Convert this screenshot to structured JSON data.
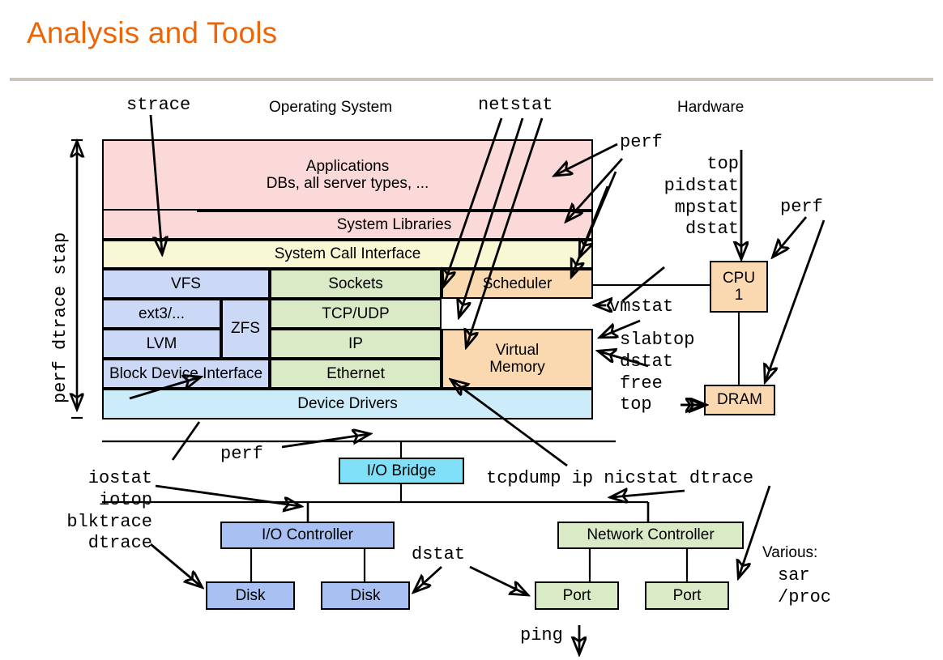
{
  "slide": {
    "title": "Analysis and Tools"
  },
  "headers": {
    "operating_system": "Operating System",
    "hardware": "Hardware"
  },
  "left_axis": {
    "label": "perf dtrace stap"
  },
  "os_stack": {
    "applications_line1": "Applications",
    "applications_line2": "DBs, all server types, ...",
    "system_libraries": "System Libraries",
    "system_call_interface": "System Call Interface",
    "vfs": "VFS",
    "ext3": "ext3/...",
    "zfs": "ZFS",
    "lvm": "LVM",
    "block_device_interface": "Block Device Interface",
    "sockets": "Sockets",
    "tcp_udp": "TCP/UDP",
    "ip": "IP",
    "ethernet": "Ethernet",
    "scheduler": "Scheduler",
    "virtual_memory_line1": "Virtual",
    "virtual_memory_line2": "Memory",
    "device_drivers": "Device Drivers"
  },
  "hardware": {
    "cpu_line1": "CPU",
    "cpu_line2": "1",
    "dram": "DRAM",
    "io_bridge": "I/O Bridge",
    "io_controller": "I/O Controller",
    "network_controller": "Network Controller",
    "disk_1": "Disk",
    "disk_2": "Disk",
    "port_1": "Port",
    "port_2": "Port"
  },
  "tools": {
    "strace": "strace",
    "netstat": "netstat",
    "perf_top_right": "perf",
    "cpu_tools": "top\npidstat\nmpstat\ndstat",
    "perf_cpu": "perf",
    "vmstat": "vmstat",
    "memory_tools": "slabtop\ndstat\nfree\ntop",
    "perf_bridge": "perf",
    "io_tools": "iostat\niotop\nblktrace\ndtrace",
    "net_tools": "tcpdump ip nicstat dtrace",
    "dstat": "dstat",
    "ping": "ping",
    "various_label": "Various:",
    "various_tools": "sar\n/proc"
  },
  "colors": {
    "title": "#ec6608",
    "rule": "#c9c5bd",
    "applications": "#fbd9d8",
    "syscall": "#f9f8d4",
    "filesystem": "#ccd9f6",
    "network": "#dae9c6",
    "scheduler_memory": "#fbd9b0",
    "device_drivers": "#ccecf9",
    "io_bridge": "#7fe0f8",
    "io_hardware": "#a8c0f2"
  }
}
